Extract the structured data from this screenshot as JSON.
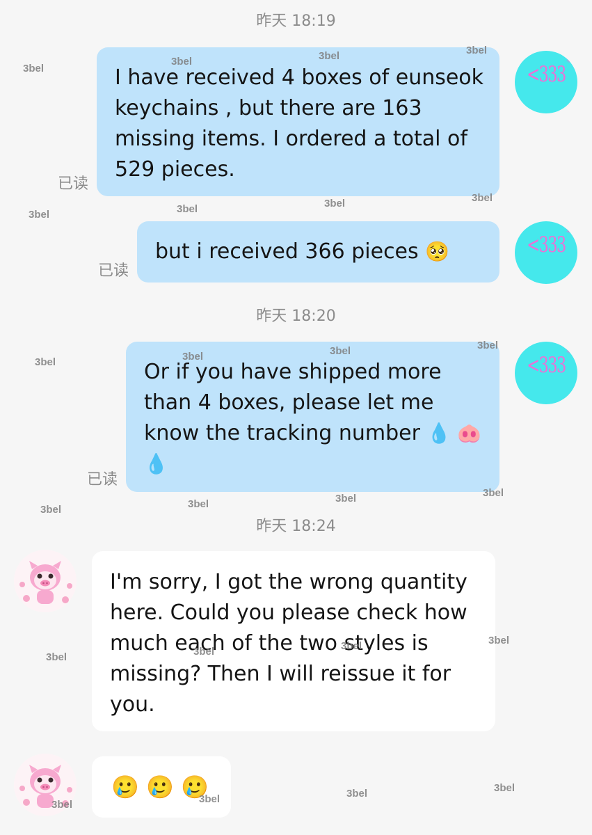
{
  "timestamps": [
    "昨天 18:19",
    "昨天 18:20",
    "昨天 18:24"
  ],
  "read_label": "已读",
  "self_avatar": {
    "text": "<333",
    "mark": "*",
    "color": "#45e8ec"
  },
  "messages": [
    {
      "sender": "self",
      "text": "I have received 4 boxes of eunseok keychains , but there are 163 missing items. I ordered a total of 529 pieces."
    },
    {
      "sender": "self",
      "text": "but i received 366 pieces",
      "emoji": "🥺"
    },
    {
      "sender": "self",
      "text": "Or if you have shipped more than 4 boxes, please let me know the tracking number",
      "emoji": "💧 🐽 💧"
    },
    {
      "sender": "other",
      "text": "I'm sorry, I got the wrong quantity here. Could you please check how much each of the two styles is missing? Then I will reissue it for you."
    },
    {
      "sender": "other",
      "emoji": "🥲 🥲 🥲"
    }
  ],
  "watermark": "3bel",
  "colors": {
    "sent_bubble": "#bfe3fb",
    "received_bubble": "#ffffff",
    "background": "#f6f6f6"
  }
}
